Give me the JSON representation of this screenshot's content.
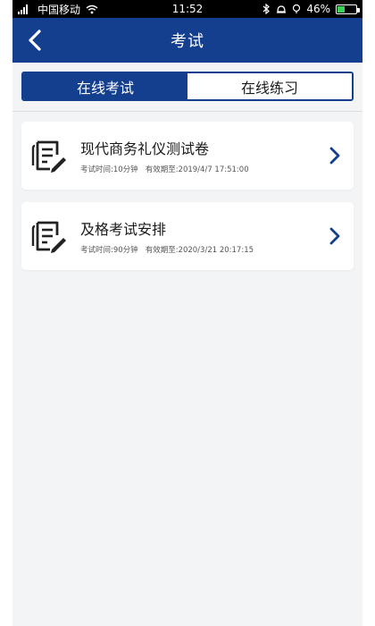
{
  "status_bar": {
    "carrier": "中国移动",
    "time": "11:52",
    "battery": "46%",
    "battery_level": 0.46
  },
  "header": {
    "title": "考试"
  },
  "tabs": [
    {
      "label": "在线考试",
      "active": true
    },
    {
      "label": "在线练习",
      "active": false
    }
  ],
  "exams": [
    {
      "title": "现代商务礼仪测试卷",
      "duration": "考试时间:10分钟",
      "expiry": "有效期至:2019/4/7 17:51:00"
    },
    {
      "title": "及格考试安排",
      "duration": "考试时间:90分钟",
      "expiry": "有效期至:2020/3/21 20:17:15"
    }
  ],
  "colors": {
    "brand": "#143f8f",
    "background": "#f3f4f6"
  }
}
